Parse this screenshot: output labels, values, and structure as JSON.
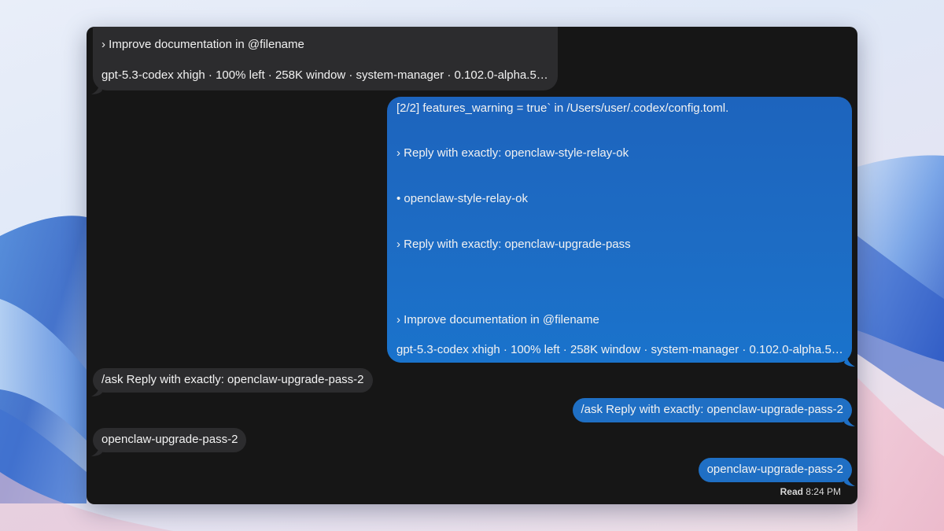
{
  "colors": {
    "window_bg": "#161616",
    "incoming_bubble": "#2c2c2e",
    "outgoing_bubble": "#1f6fc4",
    "text": "#f2f2f2"
  },
  "messages": [
    {
      "direction": "incoming",
      "lines": [
        "› Improve documentation in @filename",
        "gpt-5.3-codex xhigh · 100% left · 258K window · system-manager · 0.102.0-alpha.5 · ~/…"
      ]
    },
    {
      "direction": "outgoing",
      "lines": [
        "[2/2] features_warning = true` in /Users/user/.codex/config.toml.",
        "› Reply with exactly: openclaw-style-relay-ok",
        "• openclaw-style-relay-ok",
        "› Reply with exactly: openclaw-upgrade-pass",
        "› Improve documentation in @filename",
        "gpt-5.3-codex xhigh · 100% left · 258K window · system-manager · 0.102.0-alpha.5 · ~/…"
      ]
    },
    {
      "direction": "incoming",
      "text": "/ask Reply with exactly: openclaw-upgrade-pass-2"
    },
    {
      "direction": "outgoing",
      "text": "/ask Reply with exactly: openclaw-upgrade-pass-2"
    },
    {
      "direction": "incoming",
      "text": "openclaw-upgrade-pass-2"
    },
    {
      "direction": "outgoing",
      "text": "openclaw-upgrade-pass-2"
    }
  ],
  "receipt": {
    "label": "Read",
    "time": "8:24 PM"
  }
}
